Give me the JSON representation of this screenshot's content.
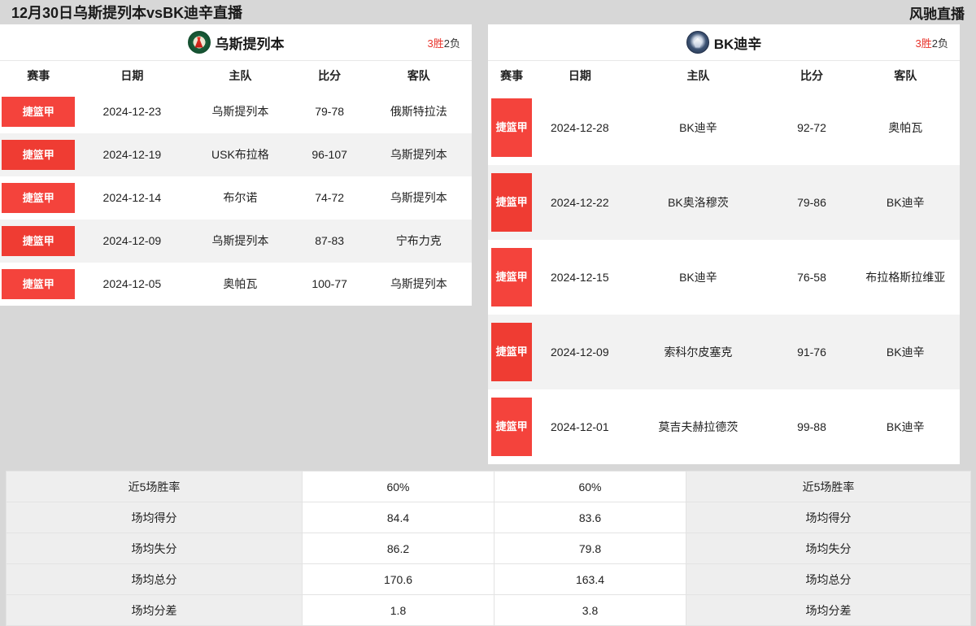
{
  "topbar": {
    "title": "12月30日乌斯提列本vsBK迪辛直播",
    "brand": "风驰直播"
  },
  "left_team": {
    "name": "乌斯提列本",
    "logo": "ostrava-crest-icon",
    "record_wins": "3胜",
    "record_losses": "2负"
  },
  "right_team": {
    "name": "BK迪辛",
    "logo": "decin-crest-icon",
    "record_wins": "3胜",
    "record_losses": "2负"
  },
  "table_headers": [
    "赛事",
    "日期",
    "主队",
    "比分",
    "客队"
  ],
  "left_matches": [
    {
      "league": "捷篮甲",
      "date": "2024-12-23",
      "home": "乌斯提列本",
      "score": "79-78",
      "away": "俄斯特拉法"
    },
    {
      "league": "捷篮甲",
      "date": "2024-12-19",
      "home": "USK布拉格",
      "score": "96-107",
      "away": "乌斯提列本"
    },
    {
      "league": "捷篮甲",
      "date": "2024-12-14",
      "home": "布尔诺",
      "score": "74-72",
      "away": "乌斯提列本"
    },
    {
      "league": "捷篮甲",
      "date": "2024-12-09",
      "home": "乌斯提列本",
      "score": "87-83",
      "away": "宁布力克"
    },
    {
      "league": "捷篮甲",
      "date": "2024-12-05",
      "home": "奥帕瓦",
      "score": "100-77",
      "away": "乌斯提列本"
    }
  ],
  "right_matches": [
    {
      "league": "捷篮甲",
      "date": "2024-12-28",
      "home": "BK迪辛",
      "score": "92-72",
      "away": "奥帕瓦"
    },
    {
      "league": "捷篮甲",
      "date": "2024-12-22",
      "home": "BK奥洛穆茨",
      "score": "79-86",
      "away": "BK迪辛"
    },
    {
      "league": "捷篮甲",
      "date": "2024-12-15",
      "home": "BK迪辛",
      "score": "76-58",
      "away": "布拉格斯拉维亚"
    },
    {
      "league": "捷篮甲",
      "date": "2024-12-09",
      "home": "索科尔皮塞克",
      "score": "91-76",
      "away": "BK迪辛"
    },
    {
      "league": "捷篮甲",
      "date": "2024-12-01",
      "home": "莫吉夫赫拉德茨",
      "score": "99-88",
      "away": "BK迪辛"
    }
  ],
  "stats": [
    {
      "label_left": "近5场胜率",
      "value_left": "60%",
      "value_right": "60%",
      "label_right": "近5场胜率"
    },
    {
      "label_left": "场均得分",
      "value_left": "84.4",
      "value_right": "83.6",
      "label_right": "场均得分"
    },
    {
      "label_left": "场均失分",
      "value_left": "86.2",
      "value_right": "79.8",
      "label_right": "场均失分"
    },
    {
      "label_left": "场均总分",
      "value_left": "170.6",
      "value_right": "163.4",
      "label_right": "场均总分"
    },
    {
      "label_left": "场均分差",
      "value_left": "1.8",
      "value_right": "3.8",
      "label_right": "场均分差"
    }
  ],
  "colors": {
    "accent_red": "#f4433c",
    "page_bg": "#d7d7d7",
    "panel_bg": "#ffffff",
    "row_alt": "#f2f2f2",
    "stat_label_bg": "#eeeeee"
  }
}
